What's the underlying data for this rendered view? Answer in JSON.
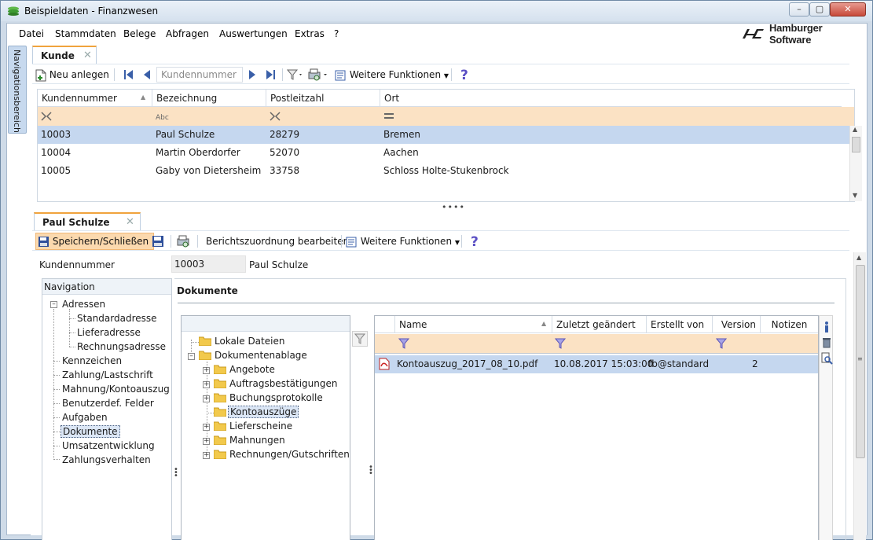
{
  "window": {
    "title": "Beispieldaten - Finanzwesen",
    "minimize": "–",
    "maximize": "▢",
    "close": "✕"
  },
  "menu": [
    "Datei",
    "Stammdaten",
    "Belege",
    "Abfragen",
    "Auswertungen",
    "Extras",
    "?"
  ],
  "brand": "Hamburger Software",
  "nav_side_label": "Navigationsbereich",
  "top_tab": {
    "label": "Kunde",
    "close": "✕"
  },
  "top_toolbar": {
    "new": "Neu anlegen",
    "search_placeholder": "Kundennummer",
    "more": "Weitere Funktionen"
  },
  "customer_grid": {
    "columns": [
      "Kundennummer",
      "Bezeichnung",
      "Postleitzahl",
      "Ort"
    ],
    "rows": [
      [
        "10003",
        "Paul Schulze",
        "28279",
        "Bremen"
      ],
      [
        "10004",
        "Martin Oberdorfer",
        "52070",
        "Aachen"
      ],
      [
        "10005",
        "Gaby von Dietersheim",
        "33758",
        "Schloss Holte-Stukenbrock"
      ]
    ],
    "selected_row": 0
  },
  "detail_tab": {
    "label": "Paul Schulze",
    "close": "✕"
  },
  "detail_toolbar": {
    "save_close": "Speichern/Schließen",
    "report": "Berichtszuordnung bearbeiten",
    "more": "Weitere Funktionen"
  },
  "kunde": {
    "label": "Kundennummer",
    "number": "10003",
    "name": "Paul Schulze"
  },
  "navigation": {
    "title": "Navigation",
    "items": [
      {
        "label": "Adressen",
        "level": 0,
        "expander": "–"
      },
      {
        "label": "Standardadresse",
        "level": 1
      },
      {
        "label": "Lieferadresse",
        "level": 1
      },
      {
        "label": "Rechnungsadresse",
        "level": 1
      },
      {
        "label": "Kennzeichen",
        "level": 0
      },
      {
        "label": "Zahlung/Lastschrift",
        "level": 0
      },
      {
        "label": "Mahnung/Kontoauszug",
        "level": 0
      },
      {
        "label": "Benutzerdef. Felder",
        "level": 0
      },
      {
        "label": "Aufgaben",
        "level": 0
      },
      {
        "label": "Dokumente",
        "level": 0,
        "selected": true
      },
      {
        "label": "Umsatzentwicklung",
        "level": 0
      },
      {
        "label": "Zahlungsverhalten",
        "level": 0
      }
    ]
  },
  "documents": {
    "title": "Dokumente",
    "folders": [
      {
        "label": "Lokale Dateien",
        "level": 0
      },
      {
        "label": "Dokumentenablage",
        "level": 0,
        "expander": "–"
      },
      {
        "label": "Angebote",
        "level": 1,
        "expander": "+"
      },
      {
        "label": "Auftragsbestätigungen",
        "level": 1,
        "expander": "+"
      },
      {
        "label": "Buchungsprotokolle",
        "level": 1,
        "expander": "+"
      },
      {
        "label": "Kontoauszüge",
        "level": 1,
        "selected": true
      },
      {
        "label": "Lieferscheine",
        "level": 1,
        "expander": "+"
      },
      {
        "label": "Mahnungen",
        "level": 1,
        "expander": "+"
      },
      {
        "label": "Rechnungen/Gutschriften",
        "level": 1,
        "expander": "+"
      }
    ],
    "file_columns": [
      "Name",
      "Zuletzt geändert",
      "Erstellt von",
      "Version",
      "Notizen"
    ],
    "files": [
      {
        "name": "Kontoauszug_2017_08_10.pdf",
        "modified": "10.08.2017 15:03:00",
        "created_by": "fb@standard",
        "version": "2",
        "notes": ""
      }
    ]
  },
  "colors": {
    "accent_orange": "#f0a33d",
    "filter_bg": "#fbe2c4",
    "selection_bg": "#c5d7ef",
    "frame_blue": "#cfdbe8"
  }
}
